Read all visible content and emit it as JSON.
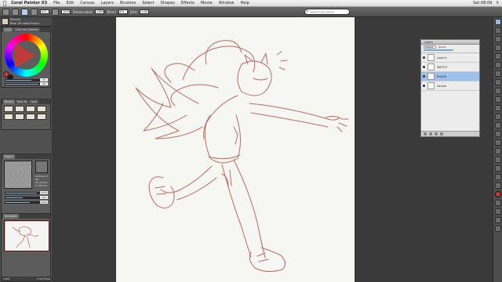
{
  "menubar": {
    "apple": "",
    "app_name": "Corel Painter X3",
    "items": [
      "File",
      "Edit",
      "Canvas",
      "Layers",
      "Brushes",
      "Select",
      "Shapes",
      "Effects",
      "Movie",
      "Window",
      "Help"
    ],
    "clock": "Sat 08:09"
  },
  "propbar": {
    "size_value": "4.0",
    "opacity_value": "100%",
    "resat_label": "Resaturation",
    "resat_value": "100%",
    "bleed_label": "Bleed",
    "bleed_value": "0%",
    "jitter_label": "Jitter",
    "jitter_value": "0.00"
  },
  "search": {
    "placeholder": "Search Brushes"
  },
  "brush_selector": {
    "category": "Pencils",
    "variant": "Real 4H Hard Pencil"
  },
  "color_panel": {
    "tabs": [
      "Color",
      "Color Set Libraries"
    ],
    "main_color": "#c23b3b",
    "additional_color": "#1e1e1e",
    "slider_1": "75",
    "slider_2": "96",
    "slider_1_fraction": 0.75,
    "slider_2_fraction": 0.96
  },
  "brush_panel": {
    "tabs": [
      "Pencils",
      "Real 4H",
      "Hard"
    ]
  },
  "paper_panel": {
    "tabs": [
      "Papers"
    ],
    "info": [
      "Soft Pencil Wa",
      "W: 320 Pix",
      "H: 300 Pix"
    ],
    "contrast_label": "Contrast",
    "contrast_value": "111%",
    "contrast_fraction": 0.9,
    "brightness_value": "0%",
    "brightness_fraction": 0.5,
    "scale_value": "100%",
    "scale_fraction": 0.7
  },
  "navigator": {
    "tabs": [
      "Navigator"
    ],
    "zoom": "100%",
    "size": "2350 Pixels"
  },
  "layers_panel": {
    "title": "Layers",
    "composite": "Default",
    "ignore_label": "Ignore",
    "layers": [
      {
        "name": "Layer 6",
        "mark": ""
      },
      {
        "name": "SKETCH",
        "mark": ""
      },
      {
        "name": "ROUGH",
        "mark": ""
      },
      {
        "name": "Canvas",
        "mark": ""
      }
    ],
    "selected_index": 2
  },
  "tools": [
    "brush-tool",
    "dropper-tool",
    "paint-bucket-tool",
    "eraser-tool",
    "layer-adjuster-tool",
    "transform-tool",
    "selection-tool",
    "lasso-tool",
    "magic-wand-tool",
    "crop-tool",
    "text-tool",
    "shape-tool",
    "pen-tool",
    "grabber-tool",
    "rotate-page-tool",
    "magnifier-tool",
    "mirror-tool",
    "perspective-tool",
    "divine-proportion-tool",
    "layout-grid-tool",
    "color-chip",
    "paper-selector",
    "gradient-selector",
    "pattern-selector",
    "nozzle-selector"
  ],
  "sketch_color": "#b5504a"
}
